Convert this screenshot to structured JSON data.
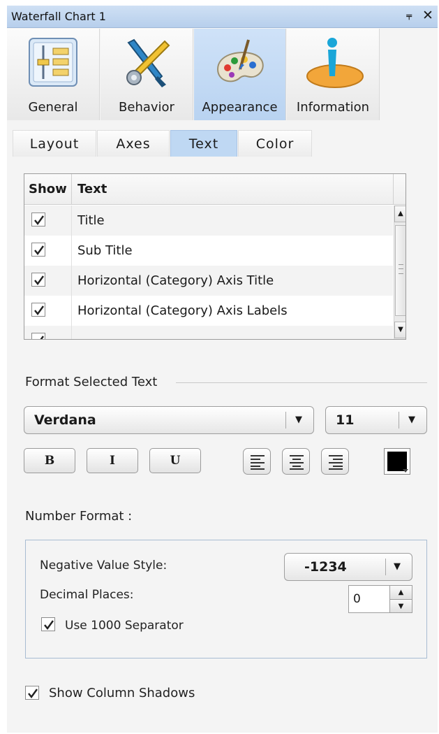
{
  "window": {
    "title": "Waterfall Chart 1",
    "pin_glyph": "⫧",
    "close_glyph": "✕"
  },
  "category_tabs": [
    {
      "label": "General",
      "icon": "general-settings-icon"
    },
    {
      "label": "Behavior",
      "icon": "tools-icon"
    },
    {
      "label": "Appearance",
      "icon": "palette-icon",
      "active": true
    },
    {
      "label": "Information",
      "icon": "info-icon"
    }
  ],
  "sub_tabs": [
    {
      "label": "Layout"
    },
    {
      "label": "Axes"
    },
    {
      "label": "Text",
      "active": true
    },
    {
      "label": "Color"
    }
  ],
  "text_table": {
    "columns": [
      "Show",
      "Text"
    ],
    "rows": [
      {
        "checked": true,
        "text": "Title"
      },
      {
        "checked": true,
        "text": "Sub Title"
      },
      {
        "checked": true,
        "text": "Horizontal (Category) Axis Title"
      },
      {
        "checked": true,
        "text": "Horizontal (Category) Axis Labels"
      },
      {
        "checked": true,
        "text": ""
      }
    ]
  },
  "format_text": {
    "label": "Format Selected Text",
    "font": "Verdana",
    "size": "11",
    "bold": "B",
    "italic": "I",
    "underline": "U",
    "color": "#000000"
  },
  "number_format": {
    "label": "Number Format :",
    "negative_label": "Negative Value Style:",
    "negative_value": "-1234",
    "decimal_label": "Decimal Places:",
    "decimal_value": "0",
    "separator_label": "Use 1000 Separator",
    "separator_checked": true
  },
  "shadows": {
    "label": "Show Column Shadows",
    "checked": true
  },
  "colors": {
    "accent": "#bfd8f3",
    "titlebar": "#c3d7ef"
  }
}
